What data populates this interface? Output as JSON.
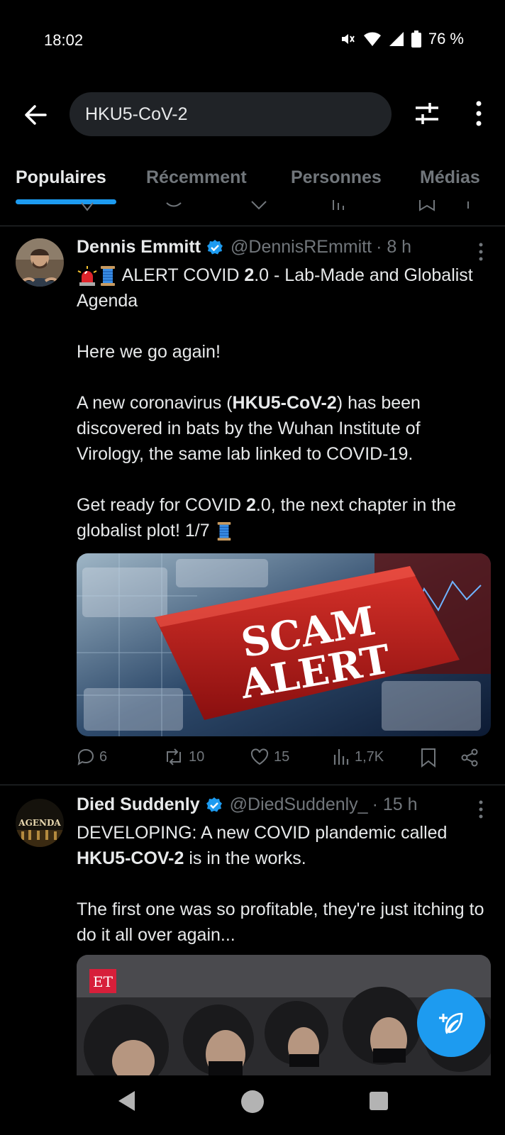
{
  "status_bar": {
    "time": "18:02",
    "battery": "76 %"
  },
  "search": {
    "query": "HKU5-CoV-2"
  },
  "tabs": [
    {
      "label": "Populaires"
    },
    {
      "label": "Récemment"
    },
    {
      "label": "Personnes"
    },
    {
      "label": "Médias"
    }
  ],
  "tweets": [
    {
      "name": "Dennis Emmitt",
      "handle": "@DennisREmmitt",
      "time": "· 8 h",
      "text_line1": "ALERT COVID ",
      "text_line1_bold": "2",
      "text_line1_rest": ".0 - Lab-Made and Globalist Agenda",
      "para2": "Here we go again!",
      "para3_pre": "A new coronavirus (",
      "para3_bold": "HKU5-CoV-2",
      "para3_post": ") has been discovered in bats by the Wuhan Institute of Virology, the same lab linked to COVID-19.",
      "para4_pre": "Get ready for COVID ",
      "para4_bold": "2",
      "para4_post": ".0, the next chapter in the globalist plot!  1/7",
      "image_text_line1": "SCAM",
      "image_text_line2": "ALERT",
      "replies": "6",
      "reposts": "10",
      "likes": "15",
      "views": "1,7K"
    },
    {
      "name": "Died Suddenly",
      "handle": "@DiedSuddenly_",
      "time": "· 15 h",
      "avatar_text": "AGENDA",
      "para1_pre": "DEVELOPING: A new COVID plandemic called ",
      "para1_bold": "HKU5-COV-2",
      "para1_post": " is in the works.",
      "para2": "The first one was so profitable, they're just itching to do it all over again...",
      "image_badge": "ET"
    }
  ],
  "colors": {
    "accent": "#1d9bf0",
    "background": "#000000",
    "muted": "#71767b",
    "text": "#e7e9ea"
  }
}
